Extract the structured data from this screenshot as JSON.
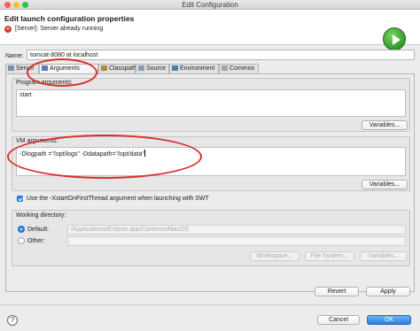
{
  "window": {
    "title": "Edit Configuration"
  },
  "header": {
    "title": "Edit launch configuration properties",
    "error_message": "[Server]: Server already running",
    "run_icon": "run-icon"
  },
  "name_field": {
    "label": "Name:",
    "value": "tomcat-8080 at localhost"
  },
  "tabs": [
    {
      "label": "Server",
      "icon": "server-icon"
    },
    {
      "label": "Arguments",
      "icon": "arguments-icon"
    },
    {
      "label": "Classpath",
      "icon": "classpath-icon"
    },
    {
      "label": "Source",
      "icon": "source-icon"
    },
    {
      "label": "Environment",
      "icon": "environment-icon"
    },
    {
      "label": "Common",
      "icon": "common-icon"
    }
  ],
  "arguments": {
    "program": {
      "label": "Program arguments:",
      "value": "start",
      "variables_button": "Variables..."
    },
    "vm": {
      "label": "VM arguments:",
      "value": "-Dlogpath =\"/opt/logs\"  -Ddatapath=\"/opt/data\"",
      "variables_button": "Variables..."
    },
    "swt_checkbox": {
      "label": "Use the -XstartOnFirstThread argument when launching with SWT",
      "checked": true
    },
    "working_directory": {
      "label": "Working directory:",
      "default_label": "Default:",
      "default_value": "/Applications/Eclipse.app/Contents/MacOS",
      "other_label": "Other:",
      "workspace_button": "Workspace...",
      "file_system_button": "File System...",
      "variables_button": "Variables..."
    }
  },
  "panel_buttons": {
    "revert": "Revert",
    "apply": "Apply"
  },
  "footer": {
    "help": "?",
    "cancel": "Cancel",
    "ok": "OK"
  },
  "colors": {
    "annotation": "#d9302a",
    "accent": "#2e86ea",
    "error": "#d0392c",
    "run": "#2f9a2a"
  }
}
